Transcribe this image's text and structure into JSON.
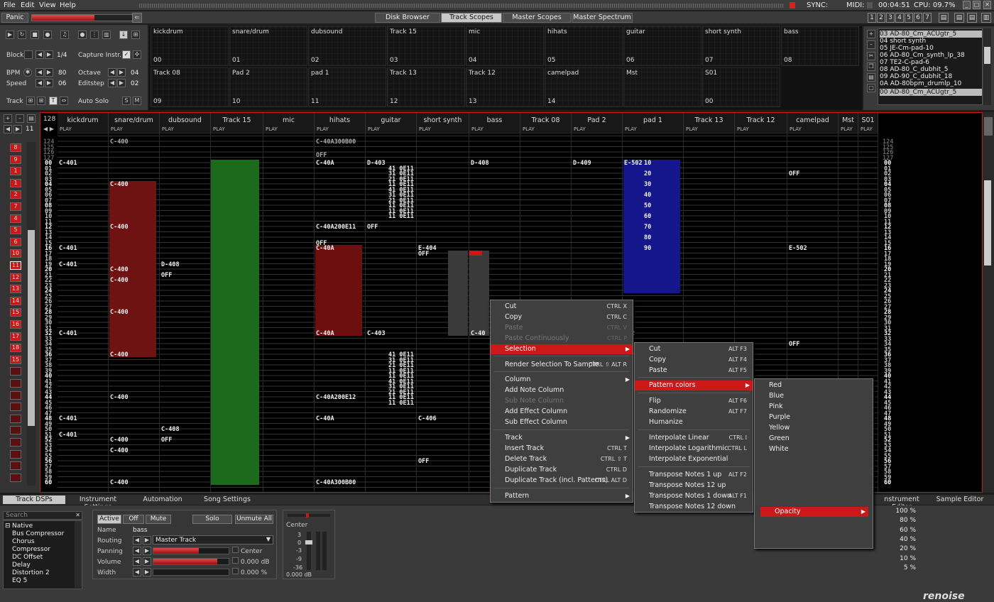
{
  "menubar": {
    "items": [
      "File",
      "Edit",
      "View",
      "Help"
    ],
    "sync_label": "SYNC:",
    "midi_label": "MIDI:",
    "time": "00:04:51",
    "cpu": "CPU: 09.7%"
  },
  "topbar": {
    "panic": "Panic",
    "volume": 0.58,
    "tabs": [
      "Disk Browser",
      "Track Scopes",
      "Master Scopes",
      "Master Spectrum"
    ],
    "selected_tab": "Track Scopes",
    "layout_numbers": [
      "1",
      "2",
      "3",
      "4",
      "5",
      "6",
      "7"
    ]
  },
  "controls": {
    "block_label": "Block",
    "block_value": "1/4",
    "capture_label": "Capture Instr.",
    "bpm_label": "BPM",
    "bpm_value": "80",
    "speed_label": "Speed",
    "speed_value": "06",
    "octave_label": "Octave",
    "octave_value": "04",
    "editstep_label": "Editstep",
    "editstep_value": "02",
    "track_label": "Track",
    "autosolo_label": "Auto Solo"
  },
  "scopes": [
    {
      "name": "kickdrum",
      "num": "00"
    },
    {
      "name": "snare/drum",
      "num": "01"
    },
    {
      "name": "dubsound",
      "num": "02"
    },
    {
      "name": "Track 15",
      "num": "03"
    },
    {
      "name": "mic",
      "num": "04"
    },
    {
      "name": "hihats",
      "num": "05"
    },
    {
      "name": "guitar",
      "num": "06"
    },
    {
      "name": "short synth",
      "num": "07"
    },
    {
      "name": "bass",
      "num": "08"
    },
    {
      "name": "Track 08",
      "num": "09"
    },
    {
      "name": "Pad 2",
      "num": "10"
    },
    {
      "name": "pad 1",
      "num": "11"
    },
    {
      "name": "Track 13",
      "num": "12"
    },
    {
      "name": "Track 12",
      "num": "13"
    },
    {
      "name": "camelpad",
      "num": "14"
    },
    {
      "name": "Mst",
      "num": ""
    },
    {
      "name": "S01",
      "num": "00"
    }
  ],
  "instruments": [
    "03 AD-80_Cm_ACUgtr_5",
    "04 short synth",
    "05 JE-Cm-pad-10",
    "06 AD-80_Cm_synth_lp_38",
    "07 TE2-C-pad-6",
    "08 AD-80_C_dubhit_5",
    "09 AD-90_C_dubhit_18",
    "0A AD-80bpm_drumlp_10",
    "00 AD-80_Cm_ACUgtr_5"
  ],
  "sequence": {
    "count": "11",
    "pattern_length": "128",
    "items": [
      "8",
      "9",
      "1",
      "1",
      "2",
      "7",
      "4",
      "5",
      "6",
      "10",
      "11",
      "12",
      "13",
      "14",
      "15",
      "16",
      "17",
      "18",
      "15"
    ]
  },
  "tracks": [
    "kickdrum",
    "snare/drum",
    "dubsound",
    "Track 15",
    "mic",
    "hihats",
    "guitar",
    "short synth",
    "bass",
    "Track 08",
    "Pad 2",
    "pad 1",
    "Track 13",
    "Track 12",
    "camelpad",
    "Mst",
    "S01"
  ],
  "play_label": "PLAY",
  "rows_top": [
    "124",
    "125",
    "126",
    "127"
  ],
  "rows": [
    "00",
    "01",
    "02",
    "03",
    "04",
    "05",
    "06",
    "07",
    "08",
    "09",
    "10",
    "11",
    "12",
    "13",
    "14",
    "15",
    "16",
    "17",
    "18",
    "19",
    "20",
    "21",
    "22",
    "23",
    "24",
    "25",
    "26",
    "27",
    "28",
    "29",
    "30",
    "31",
    "32",
    "33",
    "34",
    "35",
    "36",
    "37",
    "38",
    "39",
    "40",
    "41",
    "42",
    "43",
    "44",
    "45",
    "46",
    "47",
    "48",
    "49",
    "50",
    "51",
    "52",
    "53",
    "54",
    "55",
    "56",
    "57",
    "58",
    "59",
    "60"
  ],
  "notes": {
    "kickdrum": [
      [
        "00",
        "C-401"
      ],
      [
        "16",
        "C-401"
      ],
      [
        "19",
        "C-401"
      ],
      [
        "32",
        "C-401"
      ],
      [
        "48",
        "C-401"
      ],
      [
        "51",
        "C-401"
      ]
    ],
    "snare": [
      [
        "04",
        "C-400"
      ],
      [
        "12",
        "C-400"
      ],
      [
        "20",
        "C-400"
      ],
      [
        "22",
        "C-400"
      ],
      [
        "28",
        "C-400"
      ],
      [
        "36",
        "C-400"
      ],
      [
        "44",
        "C-400"
      ],
      [
        "52",
        "C-400"
      ],
      [
        "54",
        "C-400"
      ],
      [
        "60",
        "C-400"
      ]
    ],
    "snare_top": "C-400",
    "dubsound": [
      [
        "19",
        "D-408"
      ],
      [
        "21",
        "OFF"
      ],
      [
        "50",
        "C-408"
      ],
      [
        "52",
        "OFF"
      ]
    ],
    "hihats": [
      [
        "00",
        "C-40A"
      ],
      [
        "12",
        "C-40A200E11"
      ],
      [
        "15",
        "OFF"
      ],
      [
        "16",
        "C-40A"
      ],
      [
        "32",
        "C-40A"
      ],
      [
        "44",
        "C-40A200E12"
      ],
      [
        "48",
        "C-40A"
      ],
      [
        "60",
        "C-40A300B00"
      ]
    ],
    "hihats_top": "C-40A300B00",
    "hihats_off": "OFF",
    "guitar": [
      [
        "00",
        "D-403"
      ],
      [
        "12",
        "OFF"
      ],
      [
        "32",
        "C-403"
      ]
    ],
    "guitar_fx": [
      "41 0E11",
      "31 0E11",
      "21 0E11",
      "11 0E11",
      "41 0E11",
      "31 0E11",
      "21 0E11",
      "11 0E11",
      "11 0E11",
      "11 0E11"
    ],
    "guitar_fx2": [
      "41 0E11",
      "31 0E11",
      "21 0E11",
      "11 0E11",
      "11 0E11",
      "41 0E11",
      "31 0E11",
      "21 0E11",
      "11 0E11",
      "11 0E11"
    ],
    "shortsynth": [
      [
        "16",
        "E-404"
      ],
      [
        "17",
        "OFF"
      ],
      [
        "48",
        "C-406"
      ],
      [
        "56",
        "OFF"
      ]
    ],
    "bass": [
      [
        "00",
        "D-408"
      ],
      [
        "32",
        "C-40"
      ]
    ],
    "pad2": [
      [
        "00",
        "D-409"
      ]
    ],
    "pad1": [
      [
        "00",
        "E-502"
      ],
      [
        "32",
        "502"
      ]
    ],
    "pad1_vol": [
      "10",
      "20",
      "30",
      "40",
      "50",
      "60",
      "70",
      "80",
      "90"
    ],
    "camelpad": [
      [
        "02",
        "OFF"
      ],
      [
        "16",
        "E-502"
      ],
      [
        "34",
        "OFF"
      ]
    ]
  },
  "context_menu": {
    "items": [
      {
        "label": "Cut",
        "sc": "CTRL X"
      },
      {
        "label": "Copy",
        "sc": "CTRL C"
      },
      {
        "label": "Paste",
        "sc": "CTRL V",
        "dis": true
      },
      {
        "label": "Paste Continuously",
        "sc": "CTRL P",
        "dis": true
      },
      {
        "label": "Selection",
        "sub": true,
        "hl": true
      },
      {
        "label": "Render Selection To Sample",
        "sc": "CTRL ⇧ ALT R"
      },
      {
        "label": "Column",
        "sub": true
      },
      {
        "label": "Add Note Column"
      },
      {
        "label": "Sub Note Column",
        "dis": true
      },
      {
        "label": "Add Effect Column"
      },
      {
        "label": "Sub Effect Column"
      },
      {
        "label": "Track",
        "sub": true
      },
      {
        "label": "Insert Track",
        "sc": "CTRL T"
      },
      {
        "label": "Delete Track",
        "sc": "CTRL ⇧ T"
      },
      {
        "label": "Duplicate Track",
        "sc": "CTRL D"
      },
      {
        "label": "Duplicate Track (incl. Patterns)",
        "sc": "CTRL ALT D"
      },
      {
        "label": "Pattern",
        "sub": true
      }
    ]
  },
  "selection_menu": {
    "items": [
      {
        "label": "Cut",
        "sc": "ALT F3"
      },
      {
        "label": "Copy",
        "sc": "ALT F4"
      },
      {
        "label": "Paste",
        "sc": "ALT F5"
      },
      {
        "label": "Pattern colors",
        "sub": true,
        "hl": true
      },
      {
        "label": "Flip",
        "sc": "ALT F6"
      },
      {
        "label": "Randomize",
        "sc": "ALT F7"
      },
      {
        "label": "Humanize"
      },
      {
        "label": "Interpolate Linear",
        "sc": "CTRL I"
      },
      {
        "label": "Interpolate Logarithmic",
        "sc": "CTRL L"
      },
      {
        "label": "Interpolate Exponential"
      },
      {
        "label": "Transpose Notes 1 up",
        "sc": "ALT F2"
      },
      {
        "label": "Transpose Notes 12 up"
      },
      {
        "label": "Transpose Notes 1 down",
        "sc": "ALT F1"
      },
      {
        "label": "Transpose Notes 12 down"
      }
    ]
  },
  "color_menu": {
    "items": [
      "Red",
      "Blue",
      "Pink",
      "Purple",
      "Yellow",
      "Green",
      "White"
    ],
    "opacity": "Opacity"
  },
  "opacity_values": [
    "100 %",
    "80 %",
    "60 %",
    "40 %",
    "20 %",
    "10 %",
    "5 %"
  ],
  "bottom_tabs": [
    "Track DSPs",
    "Instrument Settings",
    "Automation",
    "Song Settings"
  ],
  "bottom_tabs_right": [
    "nstrument Editor",
    "Sample Editor"
  ],
  "dsp": {
    "search_placeholder": "Search",
    "root": "Native",
    "items": [
      "Bus Compressor",
      "Chorus",
      "Compressor",
      "DC Offset",
      "Delay",
      "Distortion 2",
      "EQ 5"
    ]
  },
  "trackprops": {
    "active": "Active",
    "off": "Off",
    "mute": "Mute",
    "solo": "Solo",
    "unmute": "Unmute All",
    "name_label": "Name",
    "name_value": "bass",
    "routing_label": "Routing",
    "routing_value": "Master Track",
    "panning_label": "Panning",
    "panning_value": "Center",
    "panning_level": 0.6,
    "volume_label": "Volume",
    "volume_value": "0.000 dB",
    "volume_level": 0.85,
    "width_label": "Width",
    "width_value": "0.000 %"
  },
  "meter": {
    "pan": "Center",
    "ticks": [
      "3",
      "0",
      "-3",
      "-9",
      "-36"
    ],
    "db": "0.000 dB"
  },
  "logo": "renoise",
  "colors": {
    "accent": "#c81818",
    "green": "#1e6f1e",
    "red": "#7a1010",
    "blue": "#1a1a9a"
  }
}
